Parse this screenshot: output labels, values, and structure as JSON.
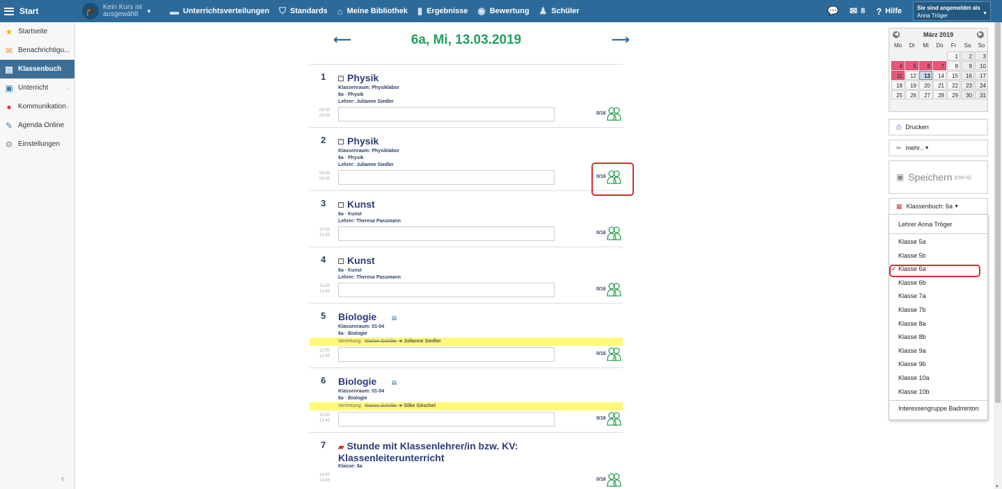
{
  "topbar": {
    "start": "Start",
    "course_line1": "Kein Kurs ist",
    "course_line2": "ausgewählt",
    "nav": [
      {
        "label": "Unterrichtsverteilungen",
        "icon": "schedule-icon"
      },
      {
        "label": "Standards",
        "icon": "shield-icon"
      },
      {
        "label": "Meine Bibliothek",
        "icon": "library-icon"
      },
      {
        "label": "Ergebnisse",
        "icon": "bar-chart-icon"
      },
      {
        "label": "Bewertung",
        "icon": "rating-icon"
      },
      {
        "label": "Schüler",
        "icon": "students-icon"
      }
    ],
    "mail_count": "8",
    "help": "Hilfe",
    "user_caption": "Sie sind angemeldet als",
    "user_name": "Anna Tröger"
  },
  "sidebar": {
    "items": [
      {
        "label": "Startseite",
        "icon": "star-icon"
      },
      {
        "label": "Benachrichtigu...",
        "icon": "envelope-icon"
      },
      {
        "label": "Klassenbuch",
        "icon": "book-icon"
      },
      {
        "label": "Unterricht",
        "icon": "classroom-icon"
      },
      {
        "label": "Kommunikation",
        "icon": "chat-icon"
      },
      {
        "label": "Agenda Online",
        "icon": "pen-icon"
      },
      {
        "label": "Einstellungen",
        "icon": "gear-icon"
      }
    ]
  },
  "main": {
    "date_title": "6a, Mi, 13.03.2019",
    "lessons": [
      {
        "num": "1",
        "title": "Physik",
        "lines": [
          {
            "k": "Klassenraum:",
            "v": "Physiklabor"
          },
          {
            "k": "6a · Physik",
            "v": ""
          },
          {
            "k": "Lehrer:",
            "v": "Julianne Siedler"
          }
        ],
        "start": "08:00",
        "end": "08:45",
        "count": "0/16"
      },
      {
        "num": "2",
        "title": "Physik",
        "lines": [
          {
            "k": "Klassenraum:",
            "v": "Physiklabor"
          },
          {
            "k": "6a · Physik",
            "v": ""
          },
          {
            "k": "Lehrer:",
            "v": "Julianne Siedler"
          }
        ],
        "start": "09:00",
        "end": "09:45",
        "count": "0/16"
      },
      {
        "num": "3",
        "title": "Kunst",
        "lines": [
          {
            "k": "6a · Kunst",
            "v": ""
          },
          {
            "k": "Lehrer:",
            "v": "Theresa Passmann"
          }
        ],
        "start": "10:00",
        "end": "10:45",
        "count": "0/16"
      },
      {
        "num": "4",
        "title": "Kunst",
        "lines": [
          {
            "k": "6a · Kunst",
            "v": ""
          },
          {
            "k": "Lehrer:",
            "v": "Theresa Passmann"
          }
        ],
        "start": "11:00",
        "end": "11:45",
        "count": "0/16"
      },
      {
        "num": "5",
        "title": "Biologie",
        "lines": [
          {
            "k": "Klassenraum:",
            "v": "01-04"
          },
          {
            "k": "6a · Biologie",
            "v": ""
          }
        ],
        "sub": {
          "label": "Vertretung:",
          "old": "Marion Schiller",
          "new": "➔ Julianne Siedler"
        },
        "start": "12:00",
        "end": "12:45",
        "count": "0/16"
      },
      {
        "num": "6",
        "title": "Biologie",
        "lines": [
          {
            "k": "Klassenraum:",
            "v": "01-04"
          },
          {
            "k": "6a · Biologie",
            "v": ""
          }
        ],
        "sub": {
          "label": "Vertretung:",
          "old": "Marion Schiller",
          "new": "➔ Silke Göschel"
        },
        "start": "13:00",
        "end": "13:45",
        "count": "0/16"
      },
      {
        "num": "7",
        "title": "Stunde mit Klassenlehrer/in bzw. KV:",
        "title2": "Klassenleiterunterricht",
        "lines": [
          {
            "k": "Klasse:",
            "v": "6a"
          }
        ],
        "start": "14:00",
        "end": "14:45",
        "count": "0/16"
      }
    ]
  },
  "calendar": {
    "month": "März 2019",
    "dow": [
      "Mo",
      "Di",
      "Mi",
      "Do",
      "Fr",
      "Sa",
      "So"
    ],
    "weeks": [
      [
        "",
        "",
        "",
        "",
        "1",
        "2",
        "3"
      ],
      [
        "4",
        "5",
        "6",
        "7",
        "8",
        "9",
        "10"
      ],
      [
        "11",
        "12",
        "13",
        "14",
        "15",
        "16",
        "17"
      ],
      [
        "18",
        "19",
        "20",
        "21",
        "22",
        "23",
        "24"
      ],
      [
        "25",
        "26",
        "27",
        "28",
        "29",
        "30",
        "31"
      ]
    ],
    "highlighted": [
      "4",
      "5",
      "6",
      "7",
      "11"
    ],
    "today": "13"
  },
  "actions": {
    "print": "Drucken",
    "more": "mehr..",
    "save": "Speichern",
    "save_hint": "(Ctrl+S)",
    "classbook": "Klassenbuch: 6a"
  },
  "dropdown": {
    "teacher": "Lehrer Anna Tröger",
    "classes": [
      "Klasse 5a",
      "Klasse 5b",
      "Klasse 6a",
      "Klasse 6b",
      "Klasse 7a",
      "Klasse 7b",
      "Klasse 8a",
      "Klasse 8b",
      "Klasse 9a",
      "Klasse 9b",
      "Klasse 10a",
      "Klasse 10b"
    ],
    "selected": "Klasse 6a",
    "group": "Interessengruppe Badminton"
  }
}
